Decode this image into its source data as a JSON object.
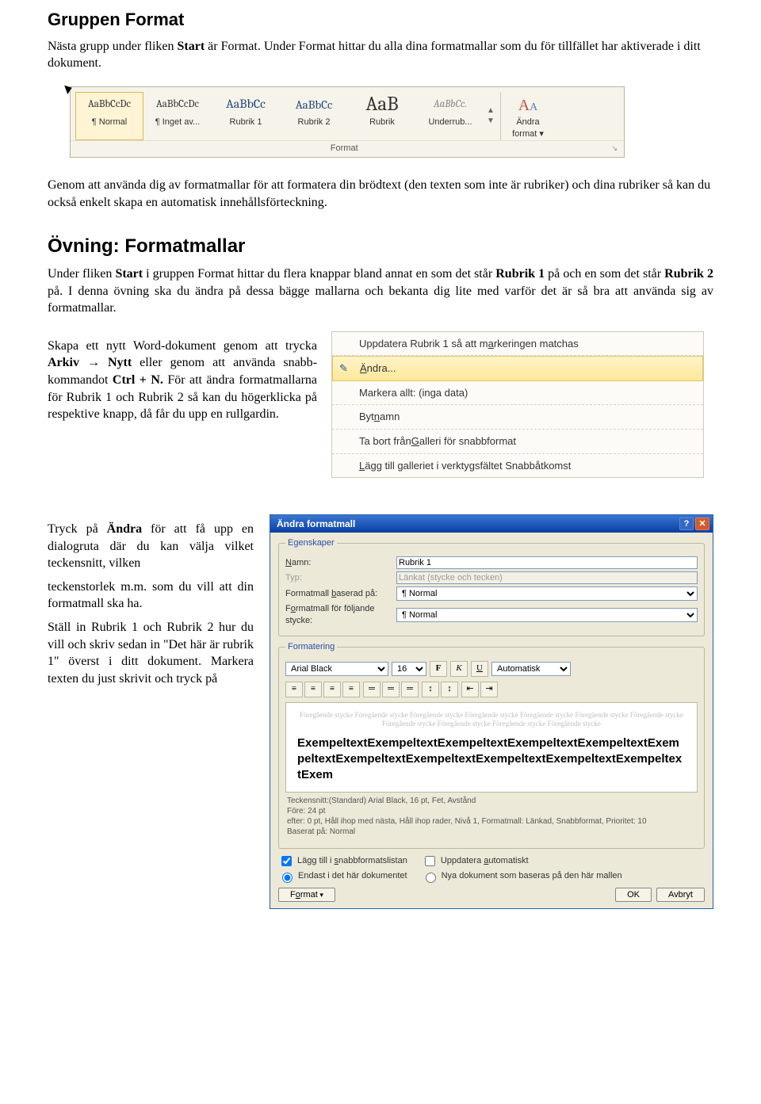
{
  "headings": {
    "h1": "Gruppen Format",
    "h2": "Övning: Formatmallar"
  },
  "paragraphs": {
    "p1_a": "Nästa grupp under fliken ",
    "p1_b": "Start",
    "p1_c": " är Format. Under Format hittar du alla dina formatmallar som du för tillfället har aktiverade i ditt dokument.",
    "p2": "Genom att använda dig av formatmallar för att formatera din brödtext (den texten som inte är rubriker) och dina rubriker så kan du också enkelt skapa en automatisk innehållsförteckning.",
    "p3_a": "Under fliken ",
    "p3_b": "Start",
    "p3_c": " i gruppen Format hittar du flera knappar bland annat en som det står ",
    "p3_d": "Rubrik 1",
    "p3_e": " på och en som det står ",
    "p3_f": "Rubrik 2",
    "p3_g": " på. I denna övning ska du ändra på dessa bägge mallarna och bekanta dig lite med varför det är så bra att använda sig av formatmallar.",
    "p4_a": "Skapa ett nytt Word-dokument genom att trycka ",
    "p4_b": "Arkiv",
    "p4_c": " → ",
    "p4_d": "Nytt",
    "p4_e": " eller genom att använda snabb­kommandot ",
    "p4_f": "Ctrl + N.",
    "p4_g": " För att ändra formatmallarna för Rubrik 1 och Rubrik 2 så kan du högerklicka på respektive knapp, då får du upp en rullgardin.",
    "p5_a": "Tryck på ",
    "p5_b": "Ändra",
    "p5_c": " för att få upp en dialogruta där du kan välja vilket teckensnitt, vilken",
    "p6": "teckenstorlek m.m. som du vill att din formatmall ska ha.",
    "p7": "Ställ in Rubrik 1 och Rubrik 2 hur du vill och skriv sedan in \"Det här är rubrik 1\" överst i ditt dokument. Markera texten du just skrivit och tryck på"
  },
  "ribbon": {
    "styles": [
      {
        "preview": "AaBbCcDc",
        "name": "¶ Normal",
        "selected": true,
        "size": "13px",
        "color": "#333"
      },
      {
        "preview": "AaBbCcDc",
        "name": "¶ Inget av...",
        "selected": false,
        "size": "13px",
        "color": "#333"
      },
      {
        "preview": "AaBbCc",
        "name": "Rubrik 1",
        "selected": false,
        "size": "16px",
        "color": "#1f497d"
      },
      {
        "preview": "AaBbCc",
        "name": "Rubrik 2",
        "selected": false,
        "size": "15px",
        "color": "#1f497d"
      },
      {
        "preview": "AaB",
        "name": "Rubrik",
        "selected": false,
        "size": "25px",
        "color": "#333"
      },
      {
        "preview": "AaBbCc.",
        "name": "Underrub...",
        "selected": false,
        "size": "13px",
        "color": "#888",
        "italic": true
      }
    ],
    "more_arrow": "▾",
    "change": {
      "line1": "Ändra",
      "line2": "format ▾",
      "icon": "A"
    },
    "group_label": "Format",
    "launcher": "▫"
  },
  "context_menu": {
    "items": [
      {
        "label_a": "Uppdatera Rubrik 1 så att m",
        "label_b": "a",
        "label_c": "rkeringen matchas",
        "icon": ""
      },
      {
        "label_a": "",
        "label_b": "Ä",
        "label_c": "ndra...",
        "icon": "✎",
        "highlight": true
      },
      {
        "label_a": "Markera allt: (inga data)",
        "label_b": "",
        "label_c": "",
        "icon": ""
      },
      {
        "label_a": "Byt ",
        "label_b": "n",
        "label_c": "amn",
        "icon": ""
      },
      {
        "label_a": "Ta bort från ",
        "label_b": "G",
        "label_c": "alleri för snabbformat",
        "icon": ""
      },
      {
        "label_a": "",
        "label_b": "L",
        "label_c": "ägg till galleriet i verktygsfältet Snabbåtkomst",
        "icon": ""
      }
    ]
  },
  "dialog": {
    "title": "Ändra formatmall",
    "legend_props": "Egenskaper",
    "legend_fmt": "Formatering",
    "labels": {
      "name": "Namn:",
      "type": "Typ:",
      "based": "Formatmall baserad på:",
      "next": "Formatmall för följande stycke:"
    },
    "hotkeys": {
      "name": "N",
      "based": "b",
      "next": "o"
    },
    "values": {
      "name": "Rubrik 1",
      "type": "Länkat (stycke och tecken)",
      "based": "¶ Normal",
      "next": "¶ Normal",
      "font": "Arial Black",
      "size": "16",
      "color": "Automatisk"
    },
    "btns": {
      "bold": "F",
      "italic": "K",
      "underline": "U"
    },
    "preview_gray": "Föregående stycke Föregående stycke Föregående stycke Föregående stycke Föregående stycke Föregående stycke Föregående stycke Föregående stycke Föregående stycke Föregående stycke Föregående stycke",
    "preview_sample": "ExempeltextExempeltextExempeltextExempeltextExempeltextExempeltextExempeltextExempeltextExempeltextExempeltextExempeltextExem",
    "info_line1": "Teckensnitt:(Standard) Arial Black, 16 pt, Fet, Avstånd",
    "info_line2": "  Före:  24 pt",
    "info_line3": "  efter:  0 pt, Håll ihop med nästa, Håll ihop rader, Nivå 1, Formatmall: Länkad, Snabbformat, Prioritet: 10",
    "info_line4": "  Baserat på: Normal",
    "check1": "Lägg till i snabbformatslistan",
    "check1_hot": "s",
    "check2": "Uppdatera automatiskt",
    "check2_hot": "a",
    "radio1": "Endast i det här dokumentet",
    "radio2": "Nya dokument som baseras på den här mallen",
    "format_btn": "Format",
    "format_hot": "o",
    "ok": "OK",
    "cancel": "Avbryt"
  }
}
